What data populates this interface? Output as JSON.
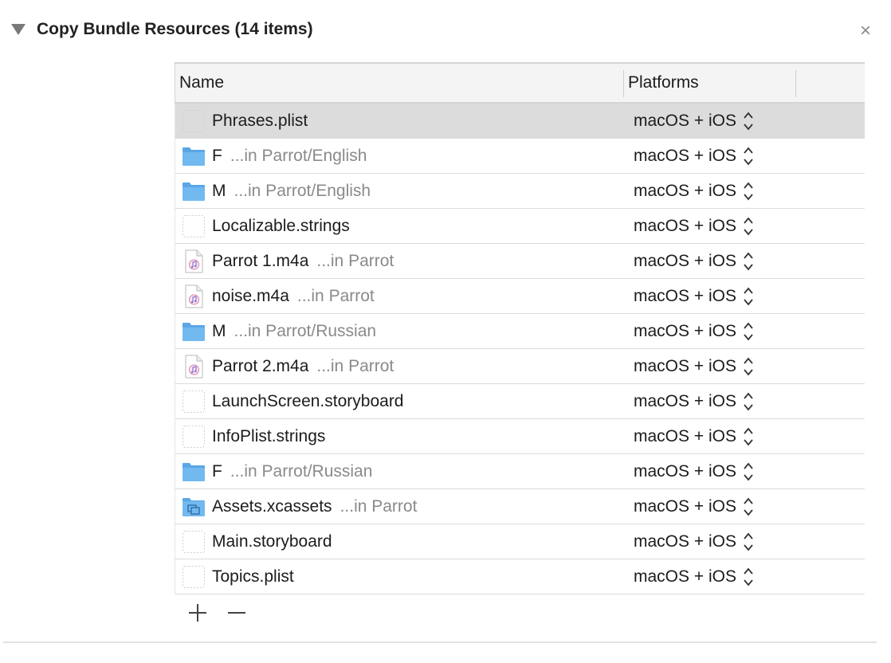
{
  "phase": {
    "title": "Copy Bundle Resources (14 items)",
    "close_glyph": "×",
    "disclosure_icon": "disclosure-triangle-down-icon"
  },
  "table": {
    "columns": [
      "Name",
      "Platforms"
    ],
    "rows": [
      {
        "name": "Phrases.plist",
        "path": "",
        "icon": "generic-file-icon",
        "platform": "macOS + iOS",
        "selected": true
      },
      {
        "name": "F",
        "path": "...in Parrot/English",
        "icon": "folder-icon",
        "platform": "macOS + iOS",
        "selected": false
      },
      {
        "name": "M",
        "path": "...in Parrot/English",
        "icon": "folder-icon",
        "platform": "macOS + iOS",
        "selected": false
      },
      {
        "name": "Localizable.strings",
        "path": "",
        "icon": "generic-file-icon",
        "platform": "macOS + iOS",
        "selected": false
      },
      {
        "name": "Parrot 1.m4a",
        "path": "...in Parrot",
        "icon": "audio-file-icon",
        "platform": "macOS + iOS",
        "selected": false
      },
      {
        "name": "noise.m4a",
        "path": "...in Parrot",
        "icon": "audio-file-icon",
        "platform": "macOS + iOS",
        "selected": false
      },
      {
        "name": "M",
        "path": "...in Parrot/Russian",
        "icon": "folder-icon",
        "platform": "macOS + iOS",
        "selected": false
      },
      {
        "name": "Parrot 2.m4a",
        "path": "...in Parrot",
        "icon": "audio-file-icon",
        "platform": "macOS + iOS",
        "selected": false
      },
      {
        "name": "LaunchScreen.storyboard",
        "path": "",
        "icon": "generic-file-icon",
        "platform": "macOS + iOS",
        "selected": false
      },
      {
        "name": "InfoPlist.strings",
        "path": "",
        "icon": "generic-file-icon",
        "platform": "macOS + iOS",
        "selected": false
      },
      {
        "name": "F",
        "path": "...in Parrot/Russian",
        "icon": "folder-icon",
        "platform": "macOS + iOS",
        "selected": false
      },
      {
        "name": "Assets.xcassets",
        "path": "...in Parrot",
        "icon": "asset-catalog-icon",
        "platform": "macOS + iOS",
        "selected": false
      },
      {
        "name": "Main.storyboard",
        "path": "",
        "icon": "generic-file-icon",
        "platform": "macOS + iOS",
        "selected": false
      },
      {
        "name": "Topics.plist",
        "path": "",
        "icon": "generic-file-icon",
        "platform": "macOS + iOS",
        "selected": false
      }
    ]
  },
  "footer": {
    "add_icon": "plus-icon",
    "remove_icon": "minus-icon"
  },
  "colors": {
    "folder_blue": "#6cb4ee",
    "selected_row": "#dcdcdc",
    "path_text": "#8a8a8a"
  }
}
